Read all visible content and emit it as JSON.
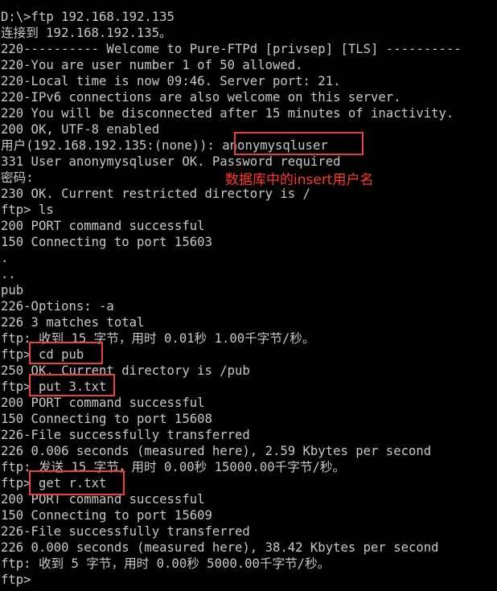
{
  "terminal": {
    "lines": [
      "D:\\>ftp 192.168.192.135",
      "连接到 192.168.192.135。",
      "220---------- Welcome to Pure-FTPd [privsep] [TLS] ----------",
      "220-You are user number 1 of 50 allowed.",
      "220-Local time is now 09:46. Server port: 21.",
      "220-IPv6 connections are also welcome on this server.",
      "220 You will be disconnected after 15 minutes of inactivity.",
      "200 OK, UTF-8 enabled",
      "用户(192.168.192.135:(none)): anonymysqluser",
      "331 User anonymysqluser OK. Password required",
      "密码:",
      "230 OK. Current restricted directory is /",
      "ftp> ls",
      "200 PORT command successful",
      "150 Connecting to port 15603",
      ".",
      "..",
      "pub",
      "226-Options: -a",
      "226 3 matches total",
      "ftp: 收到 15 字节，用时 0.01秒 1.00千字节/秒。",
      "ftp> cd pub",
      "250 OK. Current directory is /pub",
      "ftp> put 3.txt",
      "200 PORT command successful",
      "150 Connecting to port 15608",
      "226-File successfully transferred",
      "226 0.006 seconds (measured here), 2.59 Kbytes per second",
      "ftp: 发送 15 字节，用时 0.00秒 15000.00千字节/秒。",
      "ftp> get r.txt",
      "200 PORT command successful",
      "150 Connecting to port 15609",
      "226-File successfully transferred",
      "226 0.000 seconds (measured here), 38.42 Kbytes per second",
      "ftp: 收到 5 字节，用时 0.00秒 5000.00千字节/秒。",
      "ftp>"
    ]
  },
  "annotation": {
    "text": "数据库中的insert用户名",
    "color": "#ff3b30"
  },
  "colors": {
    "background": "#000000",
    "text": "#c8c8c8",
    "highlight": "#e8413a"
  }
}
